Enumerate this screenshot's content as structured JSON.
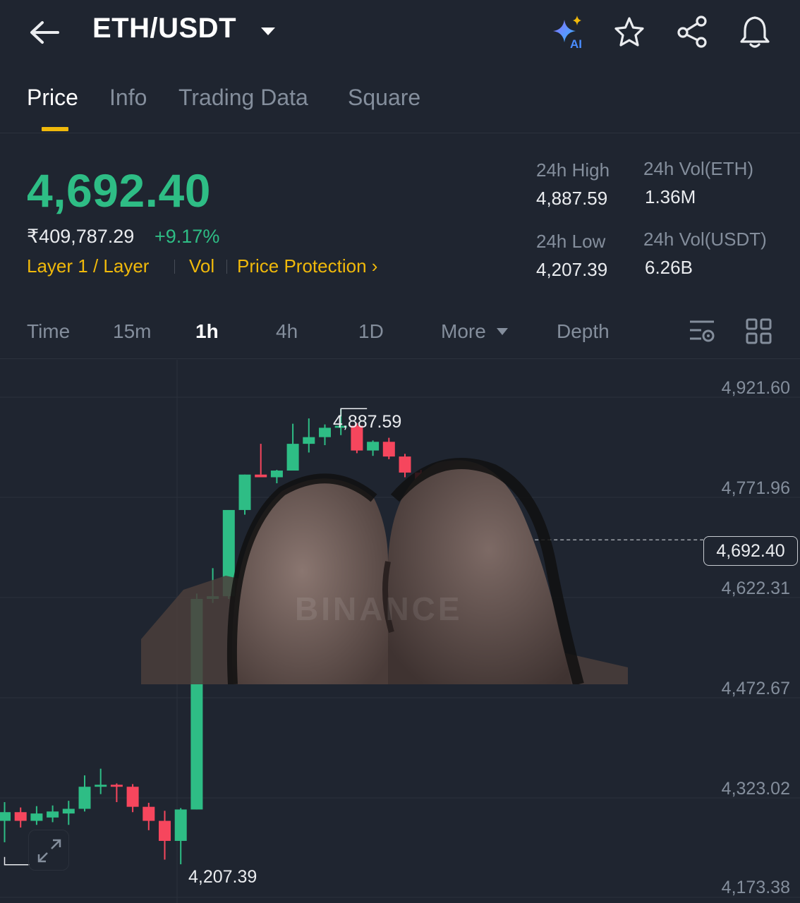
{
  "header": {
    "pair": "ETH/USDT",
    "icons": [
      "back-arrow-icon",
      "dropdown-caret-icon",
      "ai-sparkle-icon",
      "star-icon",
      "share-icon",
      "bell-icon"
    ],
    "ai_badge": "AI"
  },
  "tabs": [
    {
      "label": "Price",
      "active": true
    },
    {
      "label": "Info",
      "active": false
    },
    {
      "label": "Trading Data",
      "active": false
    },
    {
      "label": "Square",
      "active": false
    }
  ],
  "ticker": {
    "last_price": "4,692.40",
    "fiat_price": "₹409,787.29",
    "change_pct": "+9.17%",
    "tags": {
      "layer": "Layer 1 / Layer",
      "vol": "Vol",
      "protection": "Price Protection ›"
    },
    "stats": {
      "high_label": "24h High",
      "high_value": "4,887.59",
      "low_label": "24h Low",
      "low_value": "4,207.39",
      "vol_eth_label": "24h Vol(ETH)",
      "vol_eth_value": "1.36M",
      "vol_usdt_label": "24h Vol(USDT)",
      "vol_usdt_value": "6.26B"
    }
  },
  "intervals": {
    "items": [
      "Time",
      "15m",
      "1h",
      "4h",
      "1D"
    ],
    "active": "1h",
    "more_label": "More",
    "depth_label": "Depth"
  },
  "colors": {
    "up": "#2ebd85",
    "down": "#f6465d",
    "accent": "#f0b90b",
    "bg": "#1f2530"
  },
  "chart_data": {
    "type": "candlestick",
    "y_ticks": [
      "4,921.60",
      "4,771.96",
      "4,622.31",
      "4,472.67",
      "4,323.02",
      "4,173.38"
    ],
    "y_tick_values": [
      4921.6,
      4771.96,
      4622.31,
      4472.67,
      4323.02,
      4173.38
    ],
    "current_price": "4,692.40",
    "current_price_value": 4692.4,
    "annotations": {
      "high": "4,887.59",
      "low": "4,207.39"
    },
    "high_value": 4887.59,
    "low_value": 4207.39,
    "candles": [
      {
        "o": 4272,
        "h": 4300,
        "l": 4240,
        "c": 4285
      },
      {
        "o": 4285,
        "h": 4292,
        "l": 4262,
        "c": 4272
      },
      {
        "o": 4272,
        "h": 4294,
        "l": 4266,
        "c": 4283
      },
      {
        "o": 4277,
        "h": 4295,
        "l": 4270,
        "c": 4286
      },
      {
        "o": 4283,
        "h": 4302,
        "l": 4266,
        "c": 4290
      },
      {
        "o": 4290,
        "h": 4340,
        "l": 4286,
        "c": 4323
      },
      {
        "o": 4323,
        "h": 4350,
        "l": 4312,
        "c": 4326
      },
      {
        "o": 4326,
        "h": 4328,
        "l": 4300,
        "c": 4323
      },
      {
        "o": 4323,
        "h": 4327,
        "l": 4285,
        "c": 4293
      },
      {
        "o": 4293,
        "h": 4299,
        "l": 4258,
        "c": 4272
      },
      {
        "o": 4272,
        "h": 4287,
        "l": 4214,
        "c": 4242
      },
      {
        "o": 4242,
        "h": 4291,
        "l": 4207,
        "c": 4289
      },
      {
        "o": 4289,
        "h": 4612,
        "l": 4289,
        "c": 4604
      },
      {
        "o": 4604,
        "h": 4650,
        "l": 4598,
        "c": 4608
      },
      {
        "o": 4608,
        "h": 4736,
        "l": 4604,
        "c": 4737
      },
      {
        "o": 4737,
        "h": 4790,
        "l": 4730,
        "c": 4790
      },
      {
        "o": 4790,
        "h": 4836,
        "l": 4790,
        "c": 4786
      },
      {
        "o": 4786,
        "h": 4797,
        "l": 4777,
        "c": 4796
      },
      {
        "o": 4796,
        "h": 4866,
        "l": 4796,
        "c": 4836
      },
      {
        "o": 4836,
        "h": 4874,
        "l": 4823,
        "c": 4846
      },
      {
        "o": 4846,
        "h": 4865,
        "l": 4834,
        "c": 4860
      },
      {
        "o": 4860,
        "h": 4887.59,
        "l": 4849,
        "c": 4863
      },
      {
        "o": 4863,
        "h": 4867,
        "l": 4822,
        "c": 4826
      },
      {
        "o": 4826,
        "h": 4841,
        "l": 4818,
        "c": 4839
      },
      {
        "o": 4839,
        "h": 4845,
        "l": 4813,
        "c": 4817
      },
      {
        "o": 4817,
        "h": 4821,
        "l": 4786,
        "c": 4793
      },
      {
        "o": 4793,
        "h": 4797,
        "l": 4656,
        "c": 4692.4
      }
    ]
  },
  "watermark": "BINANCE"
}
